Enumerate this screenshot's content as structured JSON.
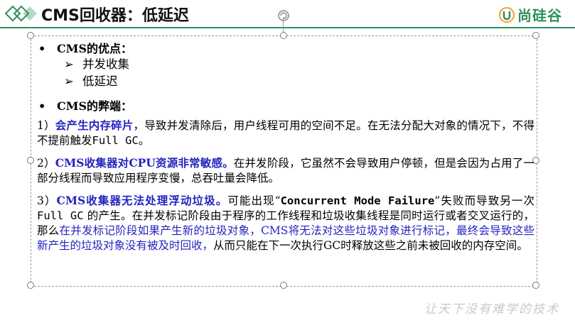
{
  "header": {
    "title": "CMS回收器：低延迟",
    "brand": "尚硅谷"
  },
  "advantages": {
    "heading": "CMS的优点：",
    "items": [
      "并发收集",
      "低延迟"
    ]
  },
  "disadvantages": {
    "heading": "CMS的弊端：",
    "p1": {
      "num": "1）",
      "highlight": "会产生内存碎片",
      "rest": "，导致并发清除后，用户线程可用的空间不足。在无法分配大对象的情况下，不得不提前触发",
      "code": "Full GC",
      "end": "。"
    },
    "p2": {
      "num": "2）",
      "highlight": "CMS收集器对CPU资源非常敏感。",
      "rest": "在并发阶段，它虽然不会导致用户停顿，但是会因为占用了一部分线程而导致应用程序变慢，总吞吐量会降低。"
    },
    "p3": {
      "num": "3）",
      "highlight": "CMS收集器无法处理浮动垃圾。",
      "a": "可能出现“",
      "code1": "Concurrent Mode Failure",
      "b": "”失败而导致另一次",
      "code2": "Full GC",
      "c": "的产生。在并发标记阶段由于程序的工作线程和垃圾收集线程是同时运行或者交叉运行的，那么",
      "blue": "在并发标记阶段如果产生新的垃圾对象，CMS将无法对这些垃圾对象进行标记，最终会导致这些新产生的垃圾对象没有被及时回收，",
      "d": "从而只能在下一次执行GC时释放这些之前未被回收的内存空间。"
    }
  },
  "watermark": "让天下没有难学的技术",
  "icons": {
    "logo": "diamond-logo-icon",
    "rotate": "rotate-handle-icon",
    "brand": "brand-u-icon",
    "arrow": "arrow-bullet-icon"
  },
  "colors": {
    "accent": "#2f8f5a",
    "highlight": "#2424c0"
  }
}
